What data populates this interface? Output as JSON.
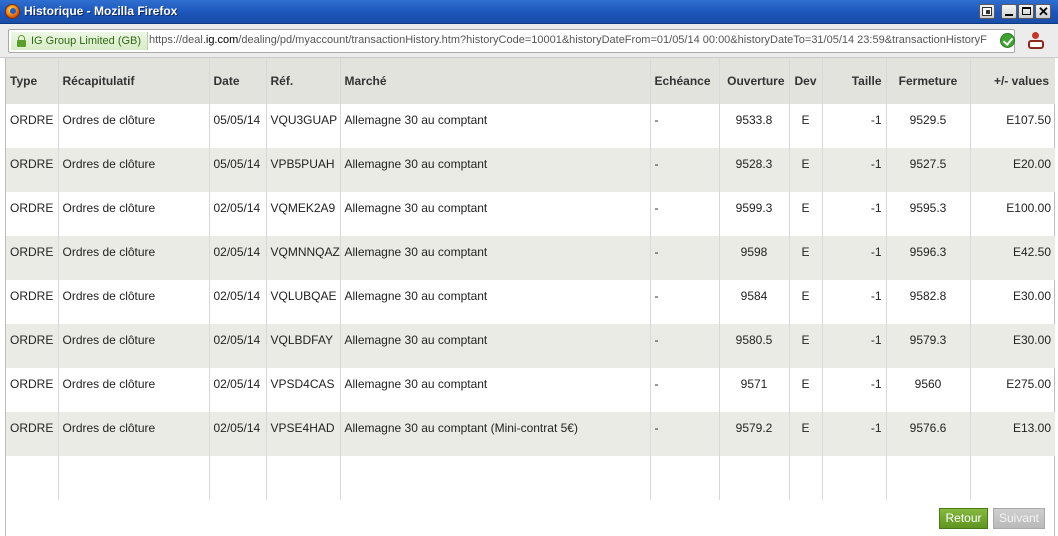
{
  "window": {
    "title": "Historique - Mozilla Firefox"
  },
  "urlbar": {
    "identity": "IG Group Limited (GB)",
    "url_prefix": "https://deal.",
    "url_host": "ig.com",
    "url_rest": "/dealing/pd/myaccount/transactionHistory.htm?historyCode=10001&historyDateFrom=01/05/14 00:00&historyDateTo=31/05/14 23:59&transactionHistoryF"
  },
  "table": {
    "headers": [
      "Type",
      "Récapitulatif",
      "Date",
      "Réf.",
      "Marché",
      "Echéance",
      "Ouverture",
      "Dev",
      "Taille",
      "Fermeture",
      "+/- values"
    ],
    "rows": [
      [
        "ORDRE",
        "Ordres de clôture",
        "05/05/14",
        "VQU3GUAP",
        "Allemagne 30 au comptant",
        "-",
        "9533.8",
        "E",
        "-1",
        "9529.5",
        "E107.50"
      ],
      [
        "ORDRE",
        "Ordres de clôture",
        "05/05/14",
        "VPB5PUAH",
        "Allemagne 30 au comptant",
        "-",
        "9528.3",
        "E",
        "-1",
        "9527.5",
        "E20.00"
      ],
      [
        "ORDRE",
        "Ordres de clôture",
        "02/05/14",
        "VQMEK2A9",
        "Allemagne 30 au comptant",
        "-",
        "9599.3",
        "E",
        "-1",
        "9595.3",
        "E100.00"
      ],
      [
        "ORDRE",
        "Ordres de clôture",
        "02/05/14",
        "VQMNNQAZ",
        "Allemagne 30 au comptant",
        "-",
        "9598",
        "E",
        "-1",
        "9596.3",
        "E42.50"
      ],
      [
        "ORDRE",
        "Ordres de clôture",
        "02/05/14",
        "VQLUBQAE",
        "Allemagne 30 au comptant",
        "-",
        "9584",
        "E",
        "-1",
        "9582.8",
        "E30.00"
      ],
      [
        "ORDRE",
        "Ordres de clôture",
        "02/05/14",
        "VQLBDFAY",
        "Allemagne 30 au comptant",
        "-",
        "9580.5",
        "E",
        "-1",
        "9579.3",
        "E30.00"
      ],
      [
        "ORDRE",
        "Ordres de clôture",
        "02/05/14",
        "VPSD4CAS",
        "Allemagne 30 au comptant",
        "-",
        "9571",
        "E",
        "-1",
        "9560",
        "E275.00"
      ],
      [
        "ORDRE",
        "Ordres de clôture",
        "02/05/14",
        "VPSE4HAD",
        "Allemagne 30 au comptant (Mini-contrat 5€)",
        "-",
        "9579.2",
        "E",
        "-1",
        "9576.6",
        "E13.00"
      ]
    ]
  },
  "buttons": {
    "retour": "Retour",
    "suivant": "Suivant"
  },
  "colors": {
    "titlebar": "#1b54b8",
    "header_row": "#e3e3de",
    "stripe_row": "#ebebe6",
    "retour_button": "#5e9420",
    "suivant_button": "#b9b9b9"
  }
}
